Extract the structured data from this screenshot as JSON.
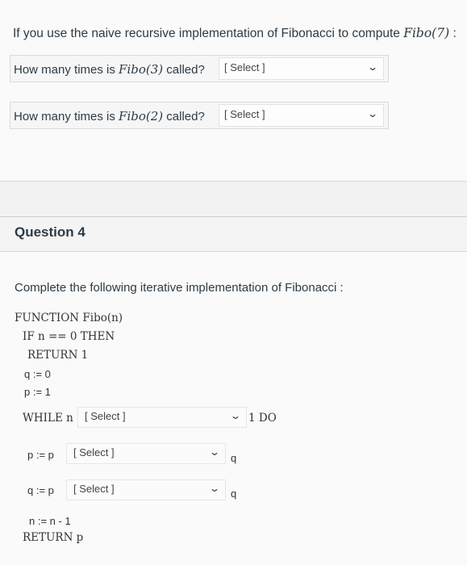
{
  "question3": {
    "intro": "If you use the naive recursive implementation of Fibonacci to compute",
    "intro_math": "Fibo(7)",
    "intro_suffix": ":",
    "items": [
      {
        "prefix": "How many times is",
        "math": "Fibo(3)",
        "suffix": "called?",
        "selected": "[ Select ]"
      },
      {
        "prefix": "How many times is",
        "math": "Fibo(2)",
        "suffix": "called?",
        "selected": "[ Select ]"
      }
    ]
  },
  "question4": {
    "title": "Question 4",
    "instruction": "Complete the following iterative implementation of Fibonacci :",
    "code": {
      "line1": "FUNCTION Fibo(n)",
      "line2": "IF n == 0 THEN",
      "line3": "RETURN 1",
      "line4": "q := 0",
      "line5": "p := 1",
      "while_prefix": "WHILE n",
      "while_select": "[ Select ]",
      "while_suffix": "1 DO",
      "p_prefix": "p := p",
      "p_select": "[ Select ]",
      "p_suffix": "q",
      "q_prefix": "q := p",
      "q_select": "[ Select ]",
      "q_suffix": "q",
      "dec": "n := n - 1",
      "ret": "RETURN p"
    }
  }
}
